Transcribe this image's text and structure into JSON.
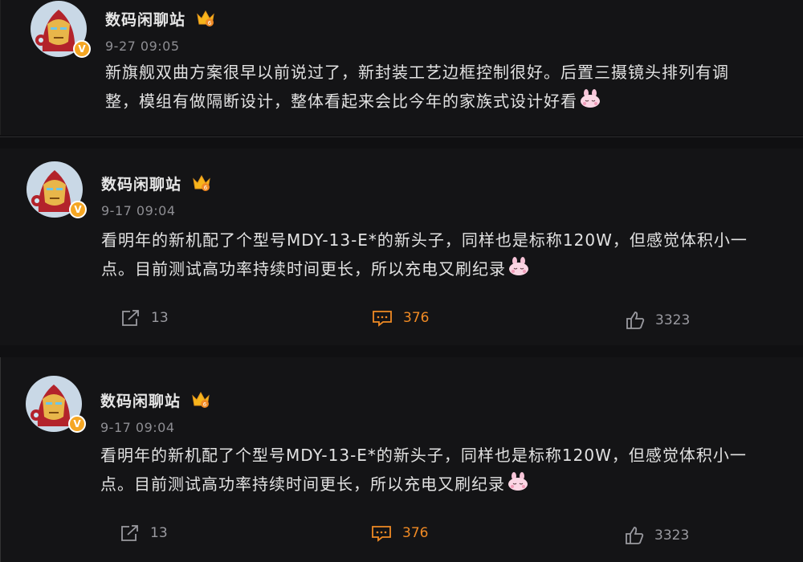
{
  "posts": [
    {
      "username": "数码闲聊站",
      "time": "9-27 09:05",
      "text_line1": "新旗舰双曲方案很早以前说过了，新封装工艺边框控制很好。后置三摄镜头排列有调",
      "text_line2": "整，模组有做隔断设计，整体看起来会比今年的家族式设计好看",
      "badge": "V"
    },
    {
      "username": "数码闲聊站",
      "time": "9-17 09:04",
      "text_line1": "看明年的新机配了个型号MDY-13-E*的新头子，同样也是标称120W，但感觉体积小一",
      "text_line2": "点。目前测试高功率持续时间更长，所以充电又刷纪录",
      "badge": "V",
      "reposts": "13",
      "comments": "376",
      "likes": "3323"
    },
    {
      "username": "数码闲聊站",
      "time": "9-17 09:04",
      "text_line1": "看明年的新机配了个型号MDY-13-E*的新头子，同样也是标称120W，但感觉体积小一",
      "text_line2": "点。目前测试高功率持续时间更长，所以充电又刷纪录",
      "badge": "V",
      "reposts": "13",
      "comments": "376",
      "likes": "3323"
    }
  ],
  "colors": {
    "accent_comment": "#f08a24",
    "verified_badge": "#f5a623",
    "text_primary": "#e2e2e2",
    "text_secondary": "#8e8e93"
  },
  "icons": [
    "avatar-ironman",
    "crown-vip-icon",
    "bunny-emoji-icon",
    "repost-icon",
    "comment-icon",
    "like-icon"
  ]
}
